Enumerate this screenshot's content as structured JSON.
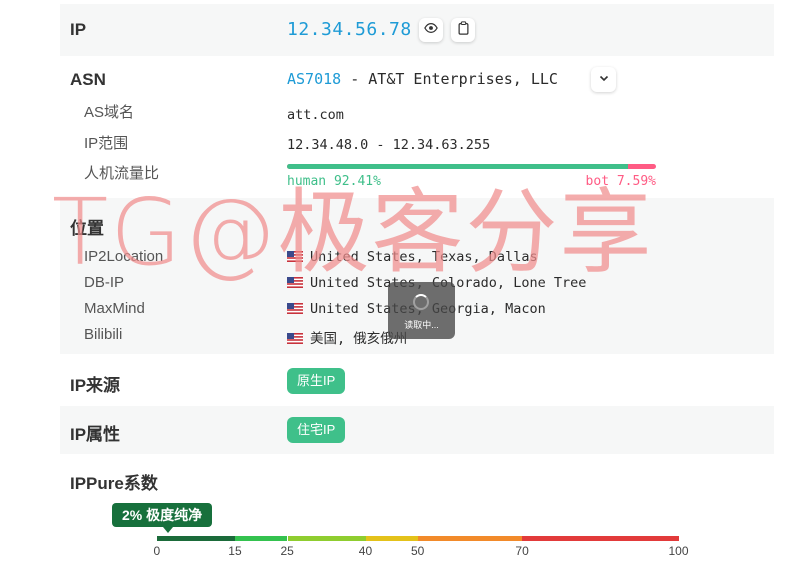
{
  "ip": {
    "label": "IP",
    "value": "12.34.56.78",
    "reveal_icon": "eye-icon",
    "copy_icon": "clipboard-icon"
  },
  "asn": {
    "label": "ASN",
    "number": "AS7018",
    "separator": " - ",
    "name": "AT&T Enterprises, LLC",
    "expand_icon": "chevron-down-icon",
    "fields": [
      {
        "label": "AS域名",
        "value": "att.com"
      },
      {
        "label": "IP范围",
        "value": "12.34.48.0 - 12.34.63.255"
      }
    ],
    "traffic": {
      "label": "人机流量比",
      "human_text": "human 92.41%",
      "bot_text": "bot 7.59%",
      "human_percent": 92.41,
      "human_color": "#3fbf8a",
      "bot_color": "#ff5b84"
    }
  },
  "location": {
    "label": "位置",
    "sources": [
      {
        "name": "IP2Location",
        "flag": "us-flag-icon",
        "value": "United States, Texas, Dallas"
      },
      {
        "name": "DB-IP",
        "flag": "us-flag-icon",
        "value": "United States, Colorado, Lone Tree"
      },
      {
        "name": "MaxMind",
        "flag": "us-flag-icon",
        "value": "United States, Georgia, Macon"
      },
      {
        "name": "Bilibili",
        "flag": "us-flag-icon",
        "value": "美国, 俄亥俄州"
      }
    ]
  },
  "source": {
    "label": "IP来源",
    "badge": "原生IP"
  },
  "attribute": {
    "label": "IP属性",
    "badge": "住宅IP"
  },
  "purity": {
    "label": "IPPure系数",
    "badge": "2% 极度纯净",
    "value_percent": 2,
    "ticks": [
      "0",
      "15",
      "25",
      "40",
      "50",
      "70",
      "100"
    ],
    "segments": [
      {
        "from": 0,
        "to": 15,
        "color": "#1b6b3a"
      },
      {
        "from": 15,
        "to": 25,
        "color": "#34c24f"
      },
      {
        "from": 25,
        "to": 40,
        "color": "#8fcd2f"
      },
      {
        "from": 40,
        "to": 50,
        "color": "#e4c21a"
      },
      {
        "from": 50,
        "to": 70,
        "color": "#f28a2a"
      },
      {
        "from": 70,
        "to": 100,
        "color": "#e23a3a"
      }
    ]
  },
  "loading": {
    "text": "读取中..."
  },
  "watermark": {
    "text": "TG@极客分享"
  },
  "colors": {
    "accent": "#1e9bd6",
    "green": "#3fc08a",
    "panel_bg": "#f6f7f7"
  }
}
